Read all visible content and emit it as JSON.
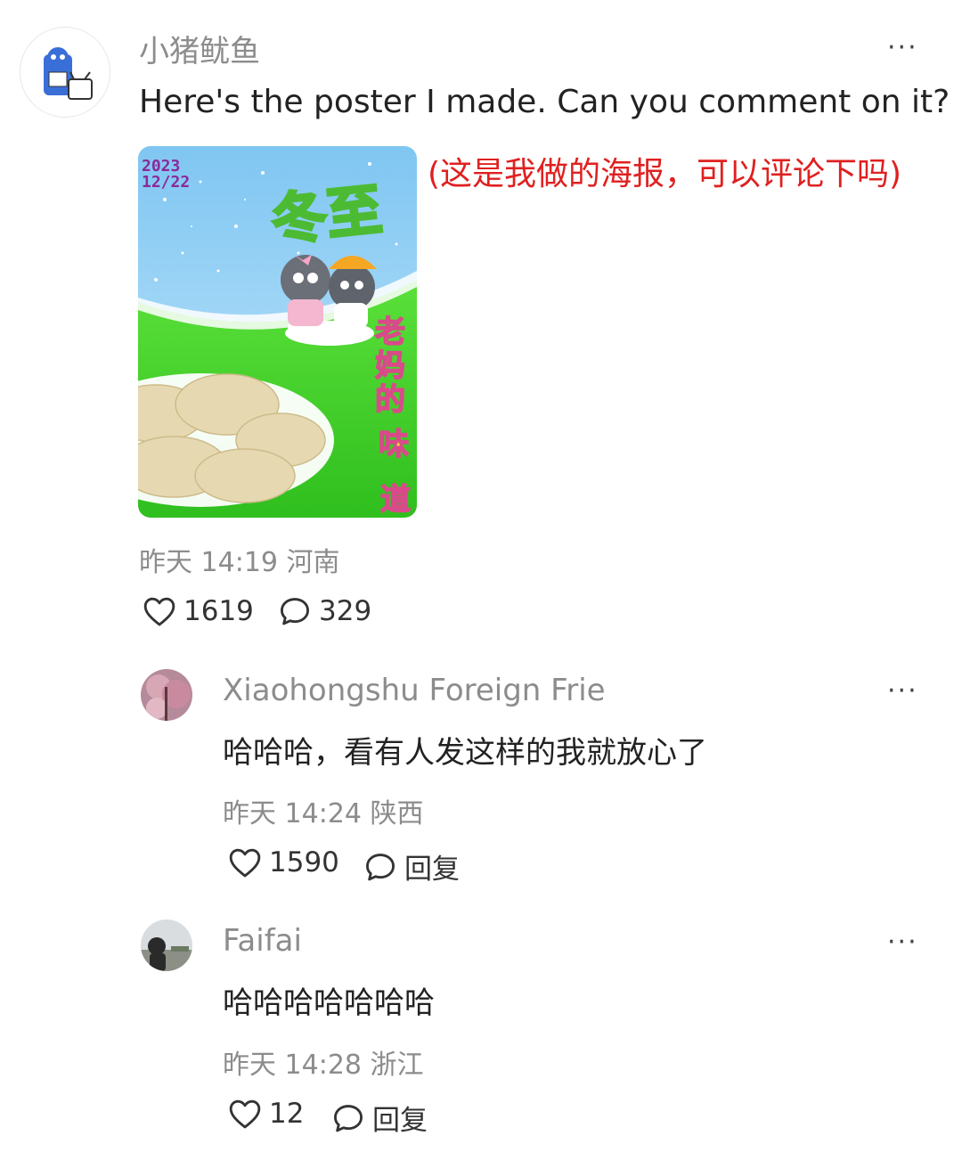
{
  "post": {
    "username": "小猪鱿鱼",
    "text": "Here's the poster I made. Can you comment on it?",
    "translation": "(这是我做的海报，可以评论下吗)",
    "poster": {
      "date_line1": "2023",
      "date_line2": "12/22",
      "title": "冬至",
      "vertical_text": [
        "老",
        "妈",
        "的",
        "味",
        "道"
      ]
    },
    "time": "昨天 14:19",
    "location": "河南",
    "likes": "1619",
    "comments": "329",
    "more_label": "···"
  },
  "comments": [
    {
      "username": "Xiaohongshu Foreign Frie",
      "text": "哈哈哈，看有人发这样的我就放心了",
      "time": "昨天 14:24",
      "location": "陕西",
      "likes": "1590",
      "reply_label": "回复",
      "more_label": "···"
    },
    {
      "username": "Faifai",
      "text": "哈哈哈哈哈哈哈",
      "time": "昨天 14:28",
      "location": "浙江",
      "likes": "12",
      "reply_label": "回复",
      "more_label": "···"
    }
  ],
  "icons": {
    "like": "heart-outline-icon",
    "comment": "speech-bubble-icon",
    "more": "ellipsis-icon"
  }
}
